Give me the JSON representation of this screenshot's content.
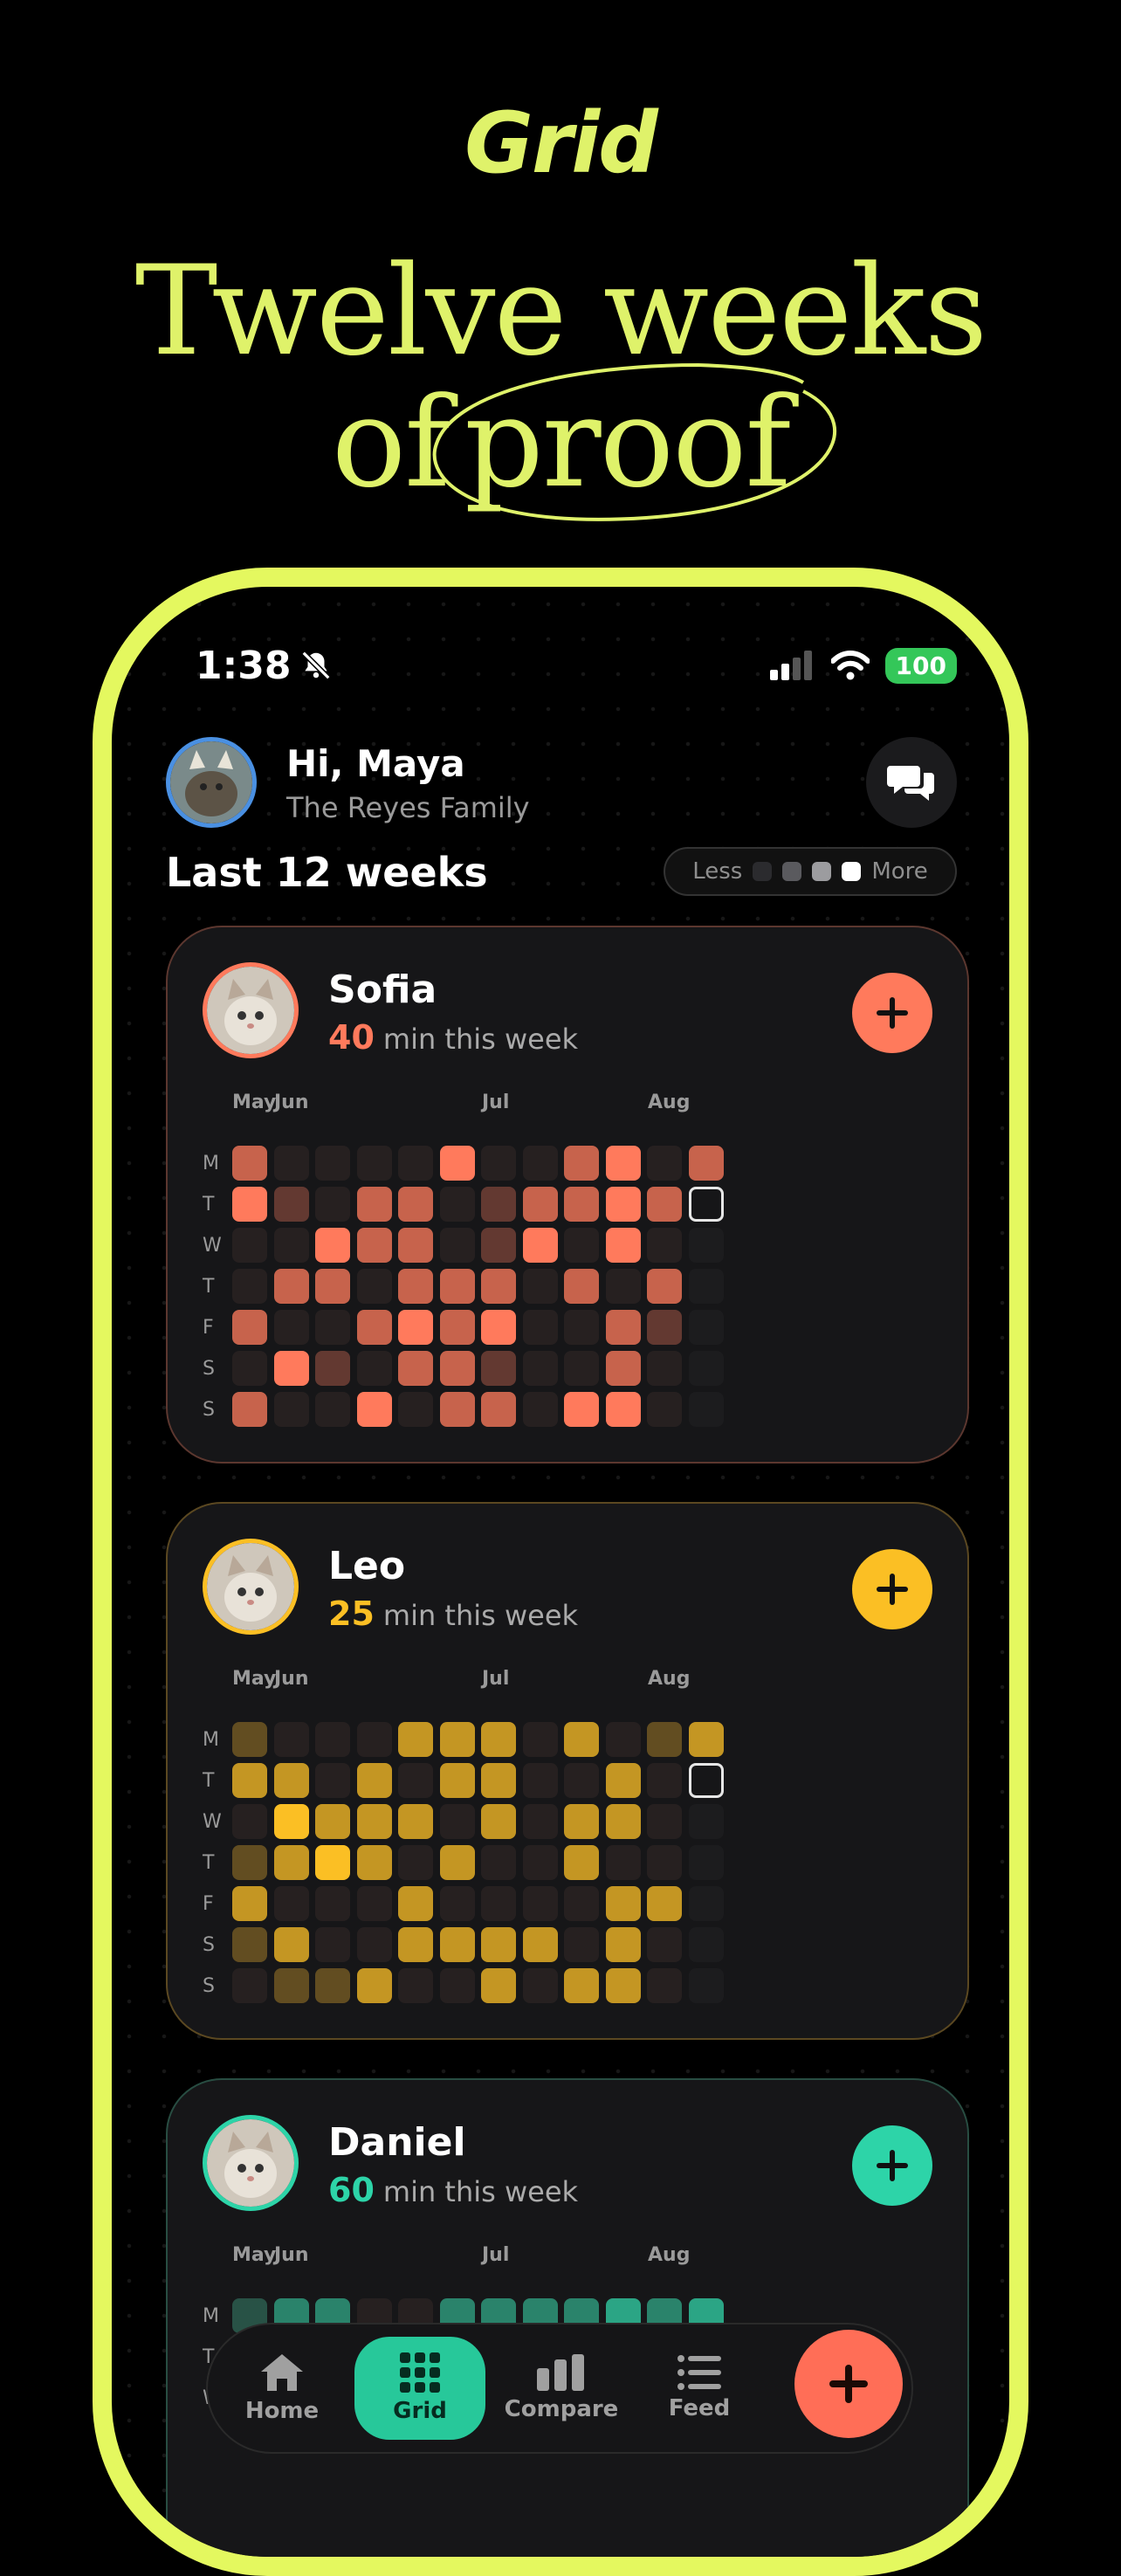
{
  "hero": {
    "brand": "Grid",
    "headline_line1": "Twelve weeks",
    "headline_of": "of",
    "headline_proof": "proof"
  },
  "status_bar": {
    "time": "1:38",
    "battery": "100"
  },
  "profile": {
    "greeting": "Hi, Maya",
    "family": "The Reyes Family"
  },
  "section": {
    "title": "Last 12 weeks"
  },
  "legend": {
    "less": "Less",
    "more": "More",
    "swatches": [
      "#2b2b2e",
      "#5a5a5e",
      "#9c9c9f",
      "#ffffff"
    ]
  },
  "day_labels": [
    "M",
    "T",
    "W",
    "T",
    "F",
    "S",
    "S"
  ],
  "members": [
    {
      "name": "Sofia",
      "minutes": "40",
      "minutes_label": "min this week",
      "accent": "#ff7a5c",
      "months": [
        "May",
        "Jun",
        "Jul",
        "Aug"
      ],
      "levels": [
        [
          3,
          0,
          0,
          0,
          0,
          4,
          0,
          0,
          3,
          4,
          0,
          3
        ],
        [
          4,
          1,
          0,
          3,
          3,
          0,
          1,
          3,
          3,
          4,
          3,
          -1
        ],
        [
          0,
          0,
          4,
          3,
          3,
          0,
          1,
          4,
          0,
          4,
          0,
          0
        ],
        [
          0,
          3,
          3,
          0,
          3,
          3,
          3,
          0,
          3,
          0,
          3,
          0
        ],
        [
          3,
          0,
          0,
          3,
          4,
          3,
          4,
          0,
          0,
          3,
          1,
          0
        ],
        [
          0,
          4,
          1,
          0,
          3,
          3,
          1,
          0,
          0,
          3,
          0,
          0
        ],
        [
          3,
          0,
          0,
          4,
          0,
          3,
          3,
          0,
          4,
          4,
          0,
          0
        ]
      ]
    },
    {
      "name": "Leo",
      "minutes": "25",
      "minutes_label": "min this week",
      "accent": "#fbbf24",
      "months": [
        "May",
        "Jun",
        "Jul",
        "Aug"
      ],
      "levels": [
        [
          1,
          0,
          0,
          0,
          3,
          3,
          3,
          0,
          3,
          0,
          1,
          3
        ],
        [
          3,
          3,
          0,
          3,
          0,
          3,
          3,
          0,
          0,
          3,
          0,
          -1
        ],
        [
          0,
          4,
          3,
          3,
          3,
          0,
          3,
          0,
          3,
          3,
          0,
          0
        ],
        [
          1,
          3,
          4,
          3,
          0,
          3,
          0,
          0,
          3,
          0,
          0,
          0
        ],
        [
          3,
          0,
          0,
          0,
          3,
          0,
          0,
          0,
          0,
          3,
          3,
          0
        ],
        [
          1,
          3,
          0,
          0,
          3,
          3,
          3,
          3,
          0,
          3,
          0,
          0
        ],
        [
          0,
          1,
          1,
          3,
          0,
          0,
          3,
          0,
          3,
          3,
          0,
          0
        ]
      ]
    },
    {
      "name": "Daniel",
      "minutes": "60",
      "minutes_label": "min this week",
      "accent": "#2dd4a8",
      "months": [
        "May",
        "Jun",
        "Jul",
        "Aug"
      ],
      "levels": [
        [
          1,
          2,
          2,
          0,
          0,
          2,
          2,
          2,
          2,
          3,
          2,
          3
        ],
        [
          0,
          0,
          0,
          0,
          0,
          0,
          0,
          0,
          0,
          0,
          0,
          0
        ],
        [
          0,
          0,
          0,
          0,
          0,
          0,
          0,
          0,
          0,
          0,
          0,
          0
        ]
      ]
    }
  ],
  "nav": {
    "items": [
      {
        "label": "Home",
        "icon": "home-icon"
      },
      {
        "label": "Grid",
        "icon": "grid-icon"
      },
      {
        "label": "Compare",
        "icon": "bar-chart-icon"
      },
      {
        "label": "Feed",
        "icon": "list-icon"
      }
    ],
    "active": "Grid"
  }
}
